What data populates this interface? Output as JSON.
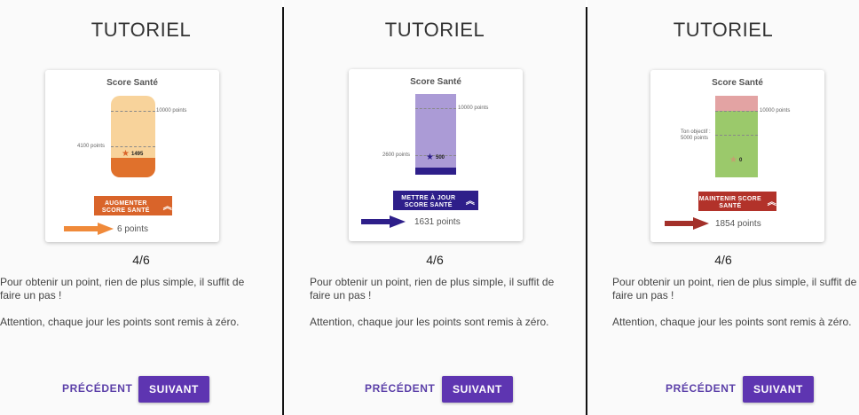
{
  "panels": [
    {
      "title": "TUTORIEL",
      "card_title": "Score Santé",
      "top_tick": "10000 points",
      "mid_tick": "4100 points",
      "star_value": "1495",
      "action_label": "AUGMENTER SCORE SANTÉ",
      "chevron": "«",
      "points_text": "6 points",
      "counter": "4/6",
      "para1": "Pour obtenir un point, rien de plus simple, il suffit de faire un pas !",
      "para2": "Attention, chaque jour les points sont remis à zéro.",
      "prev": "PRÉCÉDENT",
      "next": "SUIVANT",
      "colors": {
        "bar_top": "#f8d39b",
        "bar_bottom": "#e0712c",
        "button": "#d9642a",
        "arrow": "#f08a3a"
      }
    },
    {
      "title": "TUTORIEL",
      "card_title": "Score Santé",
      "top_tick": "10000 points",
      "mid_tick": "2600 points",
      "star_value": "500",
      "action_label": "METTRE À JOUR SCORE SANTÉ",
      "chevron": "«",
      "points_text": "1631 points",
      "counter": "4/6",
      "para1": "Pour obtenir un point, rien de plus simple, il suffit de faire un pas !",
      "para2": "Attention, chaque jour les points sont remis à zéro.",
      "prev": "PRÉCÉDENT",
      "next": "SUIVANT",
      "colors": {
        "bar_top": "#ab9bd6",
        "bar_bottom": "#2e1f8a",
        "button": "#2e1f8a",
        "arrow": "#2e1f8a"
      }
    },
    {
      "title": "TUTORIEL",
      "card_title": "Score Santé",
      "top_tick": "10000 points",
      "mid_tick": "Ton objectif : 5000 points",
      "star_value": "0",
      "action_label": "MAINTENIR SCORE SANTÉ",
      "chevron": "«",
      "points_text": "1854 points",
      "counter": "4/6",
      "para1": "Pour obtenir un point, rien de plus simple, il suffit de faire un pas !",
      "para2": "Attention, chaque jour les points sont remis à zéro.",
      "prev": "PRÉCÉDENT",
      "next": "SUIVANT",
      "colors": {
        "bar_top": "#e3a3a3",
        "bar_bottom": "#9bc96b",
        "button": "#b2322a",
        "arrow": "#a3302a"
      }
    }
  ]
}
